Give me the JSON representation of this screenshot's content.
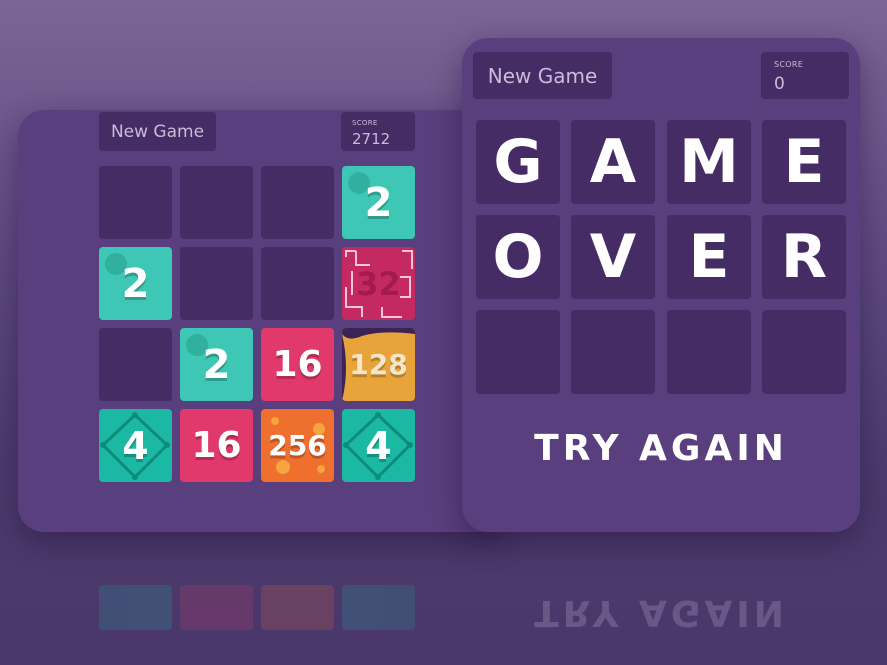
{
  "left_game": {
    "new_game_label": "New Game",
    "score_label": "SCORE",
    "score_value": "2712",
    "board": [
      [
        "",
        "",
        "",
        "2"
      ],
      [
        "2",
        "",
        "",
        "32"
      ],
      [
        "",
        "2",
        "16",
        "128"
      ],
      [
        "4",
        "16",
        "256",
        "4"
      ]
    ]
  },
  "right_game": {
    "new_game_label": "New Game",
    "score_label": "SCORE",
    "score_value": "0",
    "board": [
      [
        "G",
        "A",
        "M",
        "E"
      ],
      [
        "O",
        "V",
        "E",
        "R"
      ],
      [
        "",
        "",
        "",
        ""
      ]
    ],
    "try_again_label": "TRY AGAIN"
  },
  "colors": {
    "background": "#6a5390",
    "card": "#5a3f7e",
    "empty_tile": "#452c65",
    "tile_2": "#3dc7b4",
    "tile_4": "#1bb8a3",
    "tile_16": "#e1396b",
    "tile_32": "#c42a5f",
    "tile_128": "#e8a33a",
    "tile_256": "#ef6f2e"
  }
}
